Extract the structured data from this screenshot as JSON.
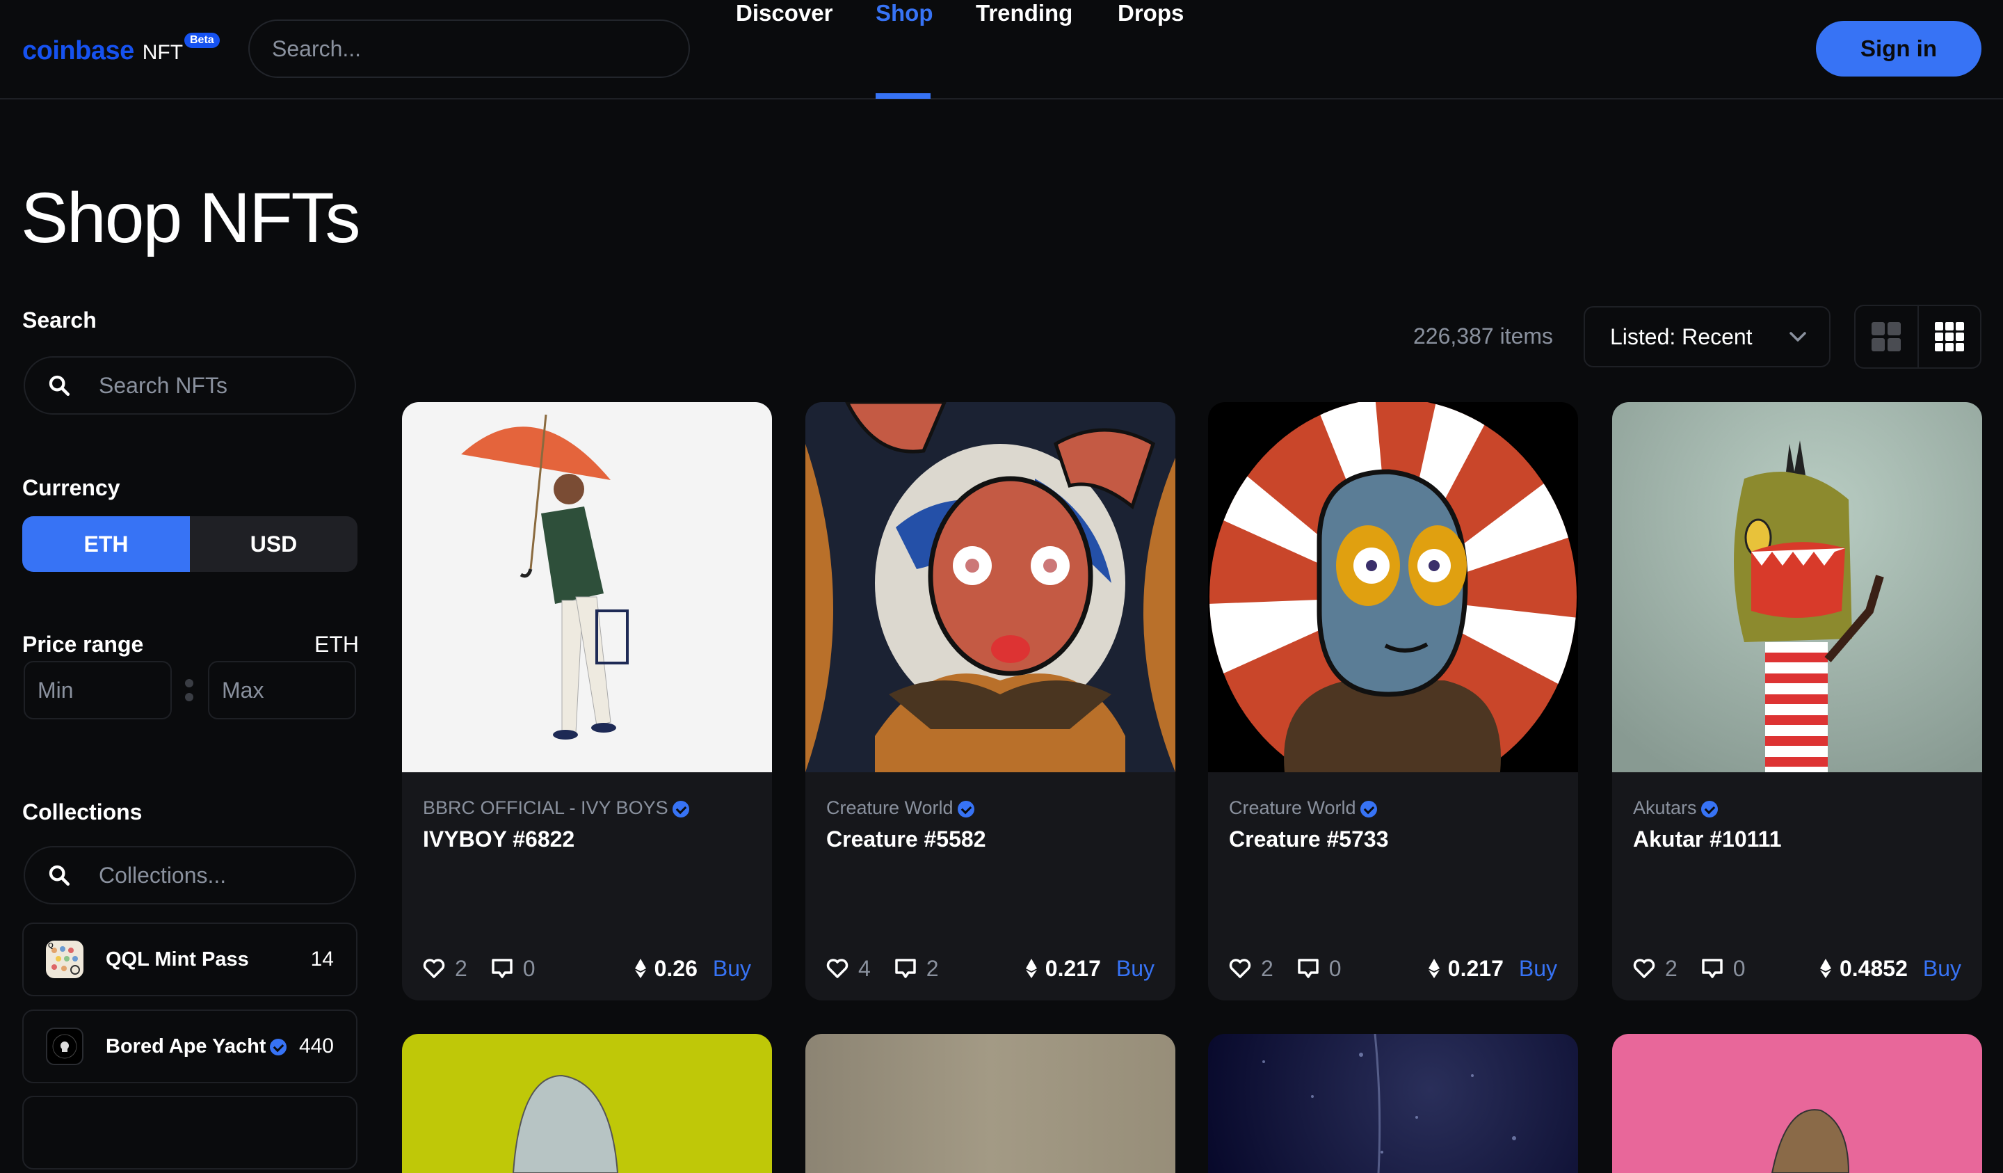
{
  "header": {
    "logo_brand": "coinbase",
    "logo_product": "NFT",
    "beta_badge": "Beta",
    "search_placeholder": "Search...",
    "nav": [
      {
        "label": "Discover",
        "active": false
      },
      {
        "label": "Shop",
        "active": true
      },
      {
        "label": "Trending",
        "active": false
      },
      {
        "label": "Drops",
        "active": false
      }
    ],
    "sign_in": "Sign in"
  },
  "page": {
    "title": "Shop NFTs"
  },
  "sidebar": {
    "search_label": "Search",
    "search_placeholder": "Search NFTs",
    "currency_label": "Currency",
    "currency_options": [
      "ETH",
      "USD"
    ],
    "currency_selected": "ETH",
    "price_label": "Price range",
    "price_unit": "ETH",
    "min_placeholder": "Min",
    "max_placeholder": "Max",
    "collections_label": "Collections",
    "collections_placeholder": "Collections...",
    "collections": [
      {
        "name": "QQL Mint Pass",
        "count": "14",
        "verified": false
      },
      {
        "name": "Bored Ape Yacht",
        "count": "440",
        "verified": true
      }
    ]
  },
  "toolbar": {
    "items_count": "226,387 items",
    "sort_label": "Listed: Recent",
    "view_modes": [
      "large-grid",
      "small-grid"
    ],
    "view_selected": "small-grid"
  },
  "cards": [
    {
      "collection": "BBRC OFFICIAL - IVY BOYS",
      "verified": true,
      "title": "IVYBOY #6822",
      "likes": "2",
      "comments": "0",
      "price": "0.26",
      "buy": "Buy"
    },
    {
      "collection": "Creature World",
      "verified": true,
      "title": "Creature #5582",
      "likes": "4",
      "comments": "2",
      "price": "0.217",
      "buy": "Buy"
    },
    {
      "collection": "Creature World",
      "verified": true,
      "title": "Creature #5733",
      "likes": "2",
      "comments": "0",
      "price": "0.217",
      "buy": "Buy"
    },
    {
      "collection": "Akutars",
      "verified": true,
      "title": "Akutar #10111",
      "likes": "2",
      "comments": "0",
      "price": "0.4852",
      "buy": "Buy"
    }
  ],
  "colors": {
    "accent": "#3773f5",
    "brand": "#1652f0",
    "background": "#0a0b0d",
    "card": "#16171b",
    "muted_text": "#8a919e"
  }
}
